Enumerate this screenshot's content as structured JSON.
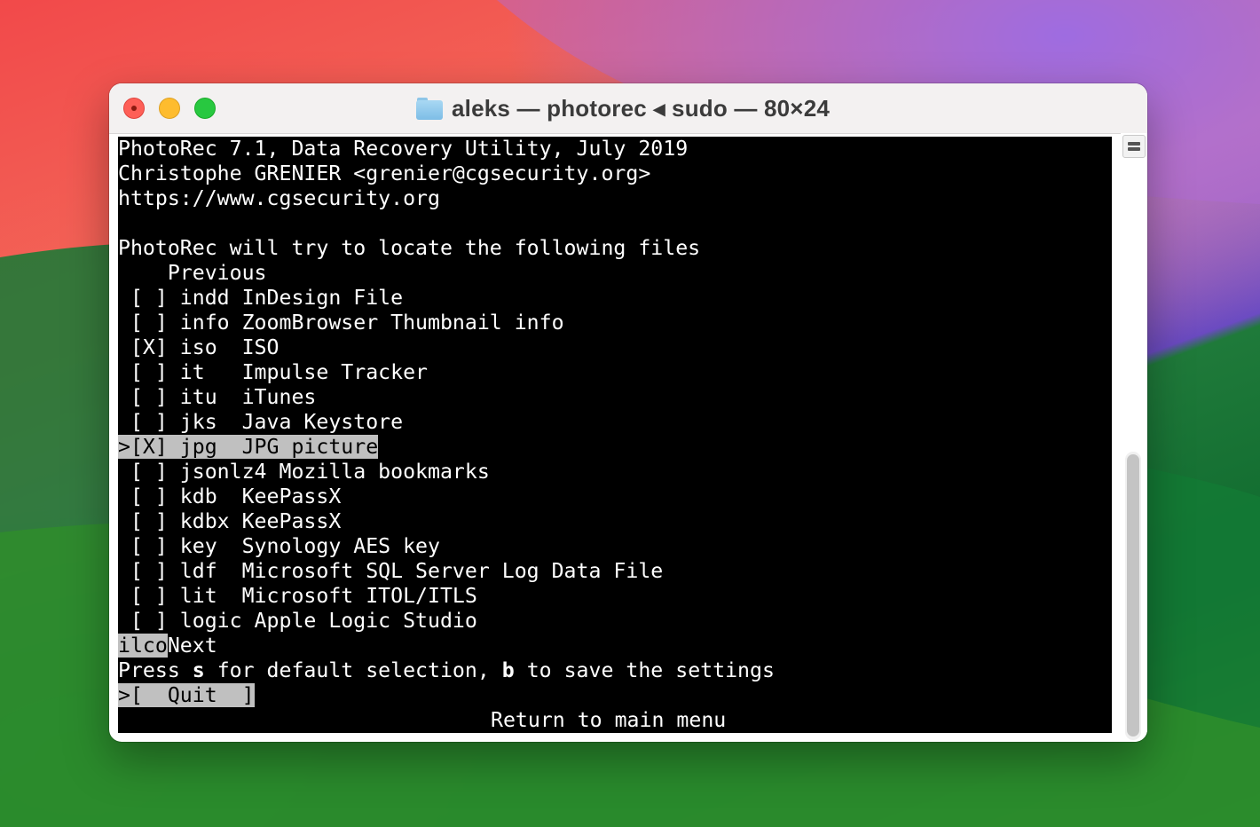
{
  "window": {
    "title": "aleks — photorec ◂ sudo — 80×24",
    "folder_icon": "folder-icon"
  },
  "terminal": {
    "lines": [
      "PhotoRec 7.1, Data Recovery Utility, July 2019",
      "Christophe GRENIER <grenier@cgsecurity.org>",
      "https://www.cgsecurity.org",
      "",
      "PhotoRec will try to locate the following files",
      "    Previous",
      " [ ] indd InDesign File",
      " [ ] info ZoomBrowser Thumbnail info",
      " [X] iso  ISO",
      " [ ] it   Impulse Tracker",
      " [ ] itu  iTunes",
      " [ ] jks  Java Keystore",
      ">[X] jpg  JPG picture",
      " [ ] jsonlz4 Mozilla bookmarks",
      " [ ] kdb  KeePassX",
      " [ ] kdbx KeePassX",
      " [ ] key  Synology AES key",
      " [ ] ldf  Microsoft SQL Server Log Data File",
      " [ ] lit  Microsoft ITOL/ITLS",
      " [ ] logic Apple Logic Studio"
    ],
    "next_hl": "ilco",
    "next_label": "Next",
    "help": {
      "p1": "Press ",
      "key_s": "s",
      "p2": " for default selection, ",
      "key_b": "b",
      "p3": " to save the settings"
    },
    "quit_button": ">[  Quit  ]",
    "status": "Return to main menu"
  }
}
